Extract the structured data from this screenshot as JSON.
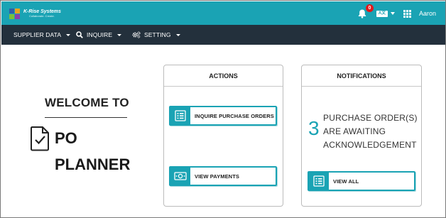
{
  "header": {
    "logo": {
      "company": "K-Rise Systems",
      "tagline": "Collaborate. Create."
    },
    "notifications_badge": "0",
    "language_label": "A文",
    "user_name": "Aaron",
    "accent_color": "#1aa3b4",
    "icons": [
      "bell-icon",
      "translate-icon",
      "apps-grid-icon"
    ]
  },
  "nav": {
    "background": "#23303c",
    "items": [
      {
        "label": "SUPPLIER DATA",
        "icon": ""
      },
      {
        "label": "INQUIRE",
        "icon": "search-icon"
      },
      {
        "label": "SETTING",
        "icon": "gears-icon"
      }
    ]
  },
  "welcome": {
    "line1": "WELCOME TO",
    "line2": "PO",
    "line3": "PLANNER"
  },
  "actions": {
    "title": "ACTIONS",
    "buttons": [
      {
        "label": "INQUIRE PURCHASE ORDERS",
        "icon": "list-icon"
      },
      {
        "label": "VIEW PAYMENTS",
        "icon": "money-icon"
      }
    ]
  },
  "notifications": {
    "title": "NOTIFICATIONS",
    "count": "3",
    "message": "PURCHASE ORDER(S) ARE AWAITING ACKNOWLEDGEMENT",
    "button_label": "VIEW ALL"
  }
}
